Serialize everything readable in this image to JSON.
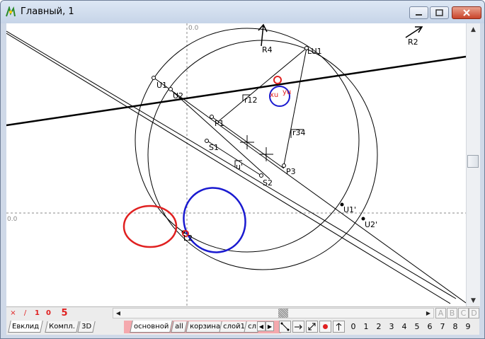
{
  "window": {
    "title": "Главный, 1"
  },
  "axes": {
    "origin_x_label": "0.0",
    "origin_y_label": "0.0"
  },
  "labels": {
    "R4": "R4",
    "LU1": "LU1",
    "R2": "R2",
    "U1": "U1",
    "U2": "U2",
    "xu": "xu",
    "yu": "yu",
    "r12": "r12",
    "P1": "P1",
    "r34": "r34",
    "S1": "S1",
    "u": "u'",
    "P3": "P3",
    "S2": "S2",
    "U1p": "U1'",
    "U2p": "U2'",
    "L2": "L2"
  },
  "toolbar_row1": {
    "btn_x": "×",
    "btn_slash": "/",
    "btn_1": "1",
    "btn_0": "0",
    "big_value": "5",
    "abcd": [
      "A",
      "B",
      "C",
      "D"
    ]
  },
  "tabs_left": [
    "Евклид",
    "Компл.",
    "3D"
  ],
  "tabs_layers": [
    "основной",
    "all",
    "корзина",
    "слой1",
    "сл"
  ],
  "digits": [
    "0",
    "1",
    "2",
    "3",
    "4",
    "5",
    "6",
    "7",
    "8",
    "9"
  ],
  "colors": {
    "red": "#e02020",
    "blue": "#1a1ad0",
    "pink": "#f5a8ad"
  }
}
